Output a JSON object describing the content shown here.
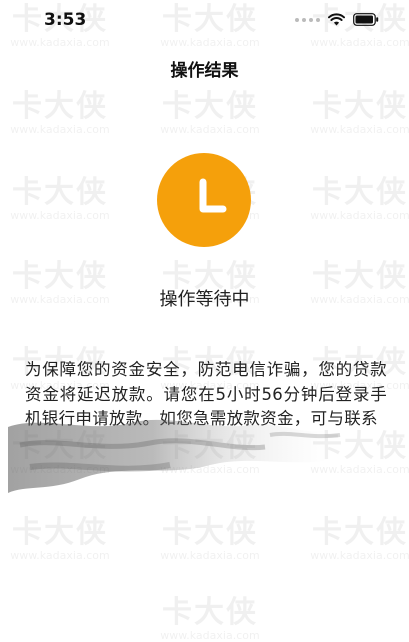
{
  "status_bar": {
    "time": "3:53"
  },
  "nav": {
    "title": "操作结果"
  },
  "result": {
    "icon": "clock-pending-icon",
    "status_text": "操作等待中",
    "message": "为保障您的资金安全，防范电信诈骗，您的贷款资金将延迟放款。请您在5小时56分钟后登录手机银行申请放款。如您急需放款资金，可与联系"
  },
  "watermark": {
    "brand": "卡大侠",
    "url": "www.kadaxia.com"
  },
  "colors": {
    "accent": "#f5a00b",
    "background": "#ffffff"
  }
}
